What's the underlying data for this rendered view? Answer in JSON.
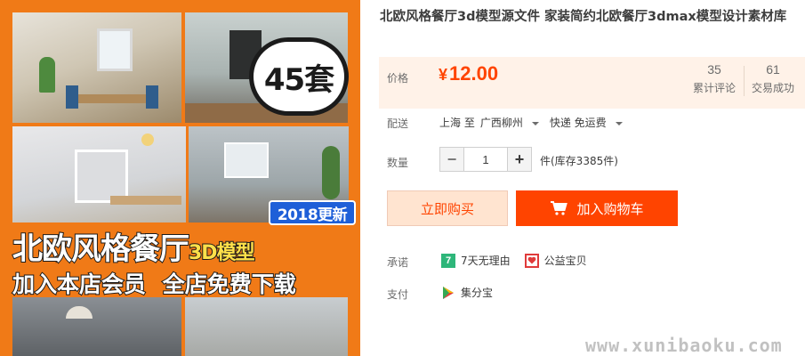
{
  "product": {
    "title": "北欧风格餐厅3d模型源文件 家装简约北欧餐厅3dmax模型设计素材库",
    "image": {
      "badge": "45套",
      "tag": "2018更新",
      "banner_title_main": "北欧风格餐厅",
      "banner_title_suffix": "3D模型",
      "banner_subtitle": "加入本店会员 全店免费下载",
      "watermark": "www.xunibaoku.com"
    }
  },
  "price": {
    "label": "价格",
    "currency": "¥",
    "value": "12.00",
    "reviews_count": "35",
    "reviews_label": "累计评论",
    "sales_count": "61",
    "sales_label": "交易成功"
  },
  "shipping": {
    "label": "配送",
    "from": "上海 至",
    "to": "广西柳州",
    "method": "快递 免运费"
  },
  "quantity": {
    "label": "数量",
    "minus": "−",
    "value": "1",
    "plus": "+",
    "unit_stock": "件(库存3385件)"
  },
  "actions": {
    "buy_now": "立即购买",
    "add_to_cart": "加入购物车"
  },
  "promise": {
    "label": "承诺",
    "item1_icon_text": "7",
    "item1": "7天无理由",
    "item2": "公益宝贝"
  },
  "payment": {
    "label": "支付",
    "item1": "集分宝"
  },
  "colors": {
    "accent": "#ff4400",
    "price_bg": "#fff2e8",
    "image_bg": "#f07a17"
  }
}
